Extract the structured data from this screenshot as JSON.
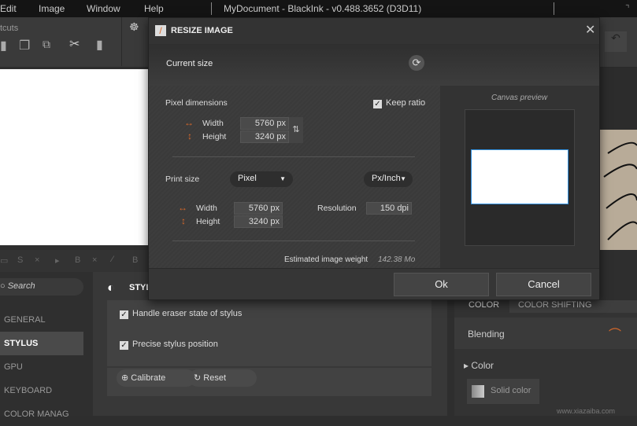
{
  "menubar": {
    "items": [
      "Edit",
      "Image",
      "Window",
      "Help"
    ],
    "title": "MyDocument - BlackInk - v0.488.3652 (D3D11)"
  },
  "toolbar": {
    "section": "tcuts"
  },
  "tools_row": [
    "S",
    "×",
    "B",
    "×",
    "B"
  ],
  "sidebar": {
    "search_placeholder": "Search",
    "items": [
      "GENERAL",
      "STYLUS",
      "GPU",
      "KEYBOARD",
      "COLOR MANAG"
    ]
  },
  "settings": {
    "header": "STYLUS",
    "handle_eraser": "Handle eraser state of stylus",
    "precise": "Precise stylus position",
    "calibrate": "Calibrate",
    "reset": "Reset"
  },
  "right_panel": {
    "tabs": [
      "COLOR",
      "COLOR SHIFTING"
    ],
    "blending": "Blending",
    "color": "Color",
    "solid_color": "Solid color"
  },
  "watermark": "www.xiazaiba.com",
  "dialog": {
    "title": "RESIZE IMAGE",
    "current_size": "Current size",
    "pixel_dimensions": "Pixel dimensions",
    "keep_ratio": "Keep ratio",
    "keep_ratio_checked": true,
    "width_label": "Width",
    "height_label": "Height",
    "px_width": "5760 px",
    "px_height": "3240 px",
    "print_size": "Print size",
    "unit_select": "Pixel",
    "res_unit_select": "Px/Inch",
    "print_width": "5760 px",
    "print_height": "3240 px",
    "resolution_label": "Resolution",
    "resolution": "150 dpi",
    "weight_label": "Estimated image weight",
    "weight": "142.38 Mo",
    "canvas_preview": "Canvas preview",
    "ok": "Ok",
    "cancel": "Cancel"
  },
  "colors": {
    "accent": "#d9692a",
    "preview_border": "#2f8fe0"
  }
}
